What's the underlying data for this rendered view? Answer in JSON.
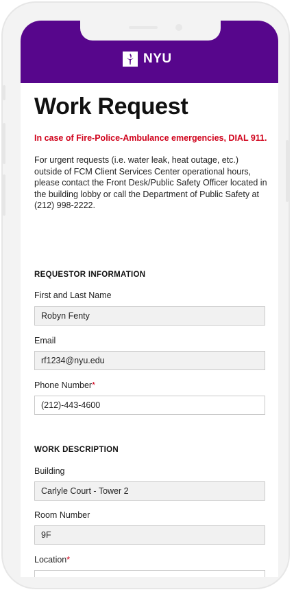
{
  "header": {
    "brand": "NYU"
  },
  "page": {
    "title": "Work Request",
    "emergency": "In case of Fire-Police-Ambulance emergencies, DIAL 911.",
    "info": "For urgent requests (i.e. water leak, heat outage, etc.) outside of FCM Client Services Center operational hours, please contact the Front Desk/Public Safety Officer located in the building lobby or call the Department of Public Safety at (212) 998-2222."
  },
  "requestor": {
    "heading": "REQUESTOR INFORMATION",
    "name_label": "First and Last Name",
    "name_value": "Robyn Fenty",
    "email_label": "Email",
    "email_value": "rf1234@nyu.edu",
    "phone_label": "Phone Number",
    "phone_value": "(212)-443-4600",
    "required_mark": "*"
  },
  "work": {
    "heading": "WORK DESCRIPTION",
    "building_label": "Building",
    "building_value": "Carlyle Court - Tower 2",
    "room_label": "Room Number",
    "room_value": "9F",
    "location_label": "Location",
    "required_mark": "*"
  },
  "colors": {
    "brand": "#57068c",
    "alert": "#d0021b"
  }
}
